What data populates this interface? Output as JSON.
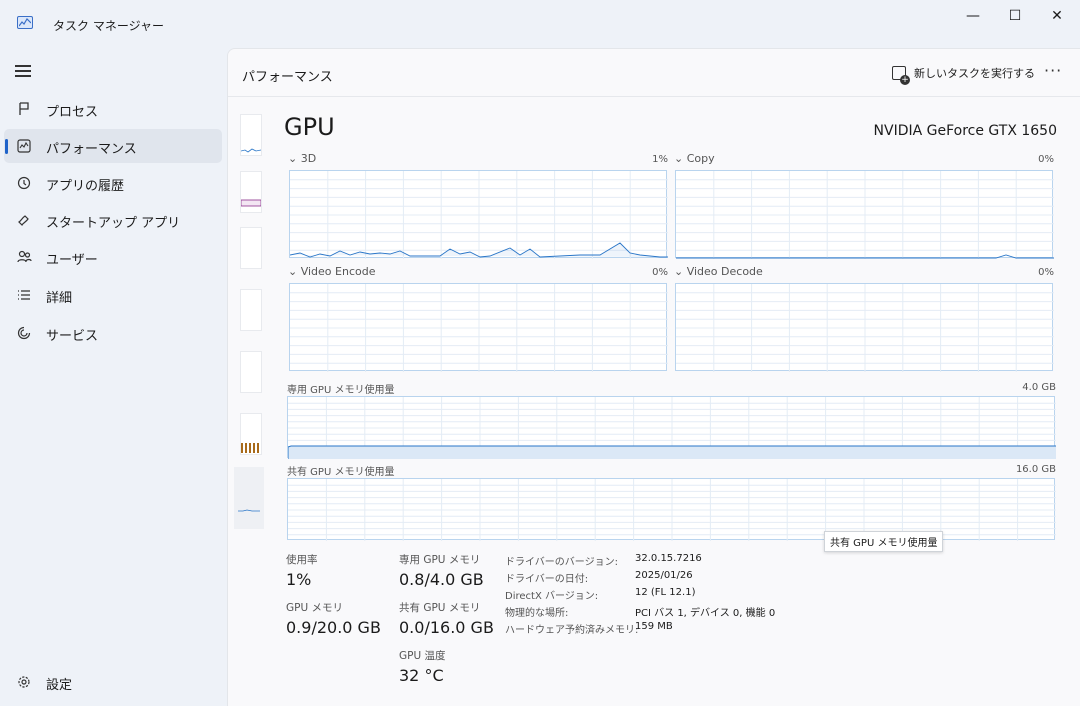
{
  "window": {
    "title": "タスク マネージャー",
    "min_icon": "—",
    "max_icon": "☐",
    "close_icon": "✕"
  },
  "sidebar": {
    "items": [
      {
        "label": "プロセス",
        "icon": "processes-icon"
      },
      {
        "label": "パフォーマンス",
        "icon": "performance-icon",
        "active": true
      },
      {
        "label": "アプリの履歴",
        "icon": "history-icon"
      },
      {
        "label": "スタートアップ アプリ",
        "icon": "startup-icon"
      },
      {
        "label": "ユーザー",
        "icon": "users-icon"
      },
      {
        "label": "詳細",
        "icon": "details-icon"
      },
      {
        "label": "サービス",
        "icon": "services-icon"
      }
    ],
    "settings_label": "設定"
  },
  "header": {
    "title": "パフォーマンス",
    "run_task_label": "新しいタスクを実行する",
    "more_label": "···"
  },
  "gpu": {
    "title": "GPU",
    "model": "NVIDIA GeForce GTX 1650",
    "engines": [
      {
        "label": "3D",
        "pct": "1%"
      },
      {
        "label": "Copy",
        "pct": "0%"
      },
      {
        "label": "Video Encode",
        "pct": "0%"
      },
      {
        "label": "Video Decode",
        "pct": "0%"
      }
    ],
    "dedicated_mem_label": "専用 GPU メモリ使用量",
    "dedicated_mem_max": "4.0 GB",
    "shared_mem_label": "共有 GPU メモリ使用量",
    "shared_mem_max": "16.0 GB",
    "tooltip": "共有 GPU メモリ使用量",
    "stats": {
      "usage_label": "使用率",
      "usage_value": "1%",
      "gpu_mem_label": "GPU メモリ",
      "gpu_mem_value": "0.9/20.0 GB",
      "dedicated_label": "専用 GPU メモリ",
      "dedicated_value": "0.8/4.0 GB",
      "shared_label": "共有 GPU メモリ",
      "shared_value": "0.0/16.0 GB",
      "temp_label": "GPU 温度",
      "temp_value": "32 °C"
    },
    "info": [
      {
        "key": "ドライバーのバージョン:",
        "value": "32.0.15.7216"
      },
      {
        "key": "ドライバーの日付:",
        "value": "2025/01/26"
      },
      {
        "key": "DirectX バージョン:",
        "value": "12 (FL 12.1)"
      },
      {
        "key": "物理的な場所:",
        "value": "PCI バス 1, デバイス 0, 機能 0"
      },
      {
        "key": "ハードウェア予約済みメモリ:",
        "value": "159 MB"
      }
    ]
  }
}
